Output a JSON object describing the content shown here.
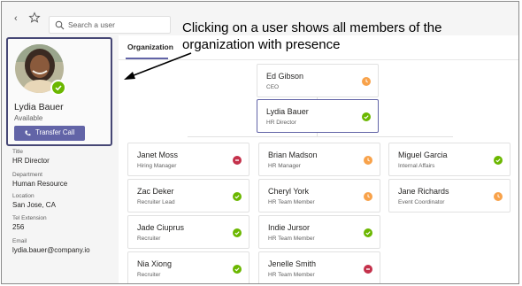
{
  "search": {
    "placeholder": "Search a user"
  },
  "callout": {
    "text": "Clicking on a user shows all members of the organization with presence"
  },
  "profile": {
    "name": "Lydia Bauer",
    "status": "Available",
    "transfer_label": "Transfer Call",
    "details": [
      {
        "label": "Title",
        "value": "HR Director"
      },
      {
        "label": "Department",
        "value": "Human Resource"
      },
      {
        "label": "Location",
        "value": "San Jose, CA"
      },
      {
        "label": "Tel Extension",
        "value": "256"
      },
      {
        "label": "Email",
        "value": "lydia.bauer@company.io"
      }
    ]
  },
  "tabs": [
    {
      "label": "Organization"
    }
  ],
  "org": {
    "manager": {
      "name": "Ed Gibson",
      "role": "CEO",
      "presence": "away"
    },
    "selected": {
      "name": "Lydia Bauer",
      "role": "HR Director",
      "presence": "available"
    },
    "reports": [
      {
        "name": "Janet Moss",
        "role": "Hiring Manager",
        "presence": "busy"
      },
      {
        "name": "Brian Madson",
        "role": "HR Manager",
        "presence": "away"
      },
      {
        "name": "Miguel Garcia",
        "role": "Internal Affairs",
        "presence": "available"
      },
      {
        "name": "Zac Deker",
        "role": "Recruiter Lead",
        "presence": "available"
      },
      {
        "name": "Cheryl York",
        "role": "HR Team Member",
        "presence": "away"
      },
      {
        "name": "Jane Richards",
        "role": "Event Coordinator",
        "presence": "away"
      },
      {
        "name": "Jade Ciuprus",
        "role": "Recruiter",
        "presence": "available"
      },
      {
        "name": "Indie Jursor",
        "role": "HR Team Member",
        "presence": "available"
      },
      {
        "name": "Nia Xiong",
        "role": "Recruiter",
        "presence": "available"
      },
      {
        "name": "Jenelle Smith",
        "role": "HR Team Member",
        "presence": "busy"
      }
    ]
  },
  "colors": {
    "available": "#6bb700",
    "away": "#f8a24a",
    "busy": "#c4314b",
    "accent": "#6264a7"
  }
}
